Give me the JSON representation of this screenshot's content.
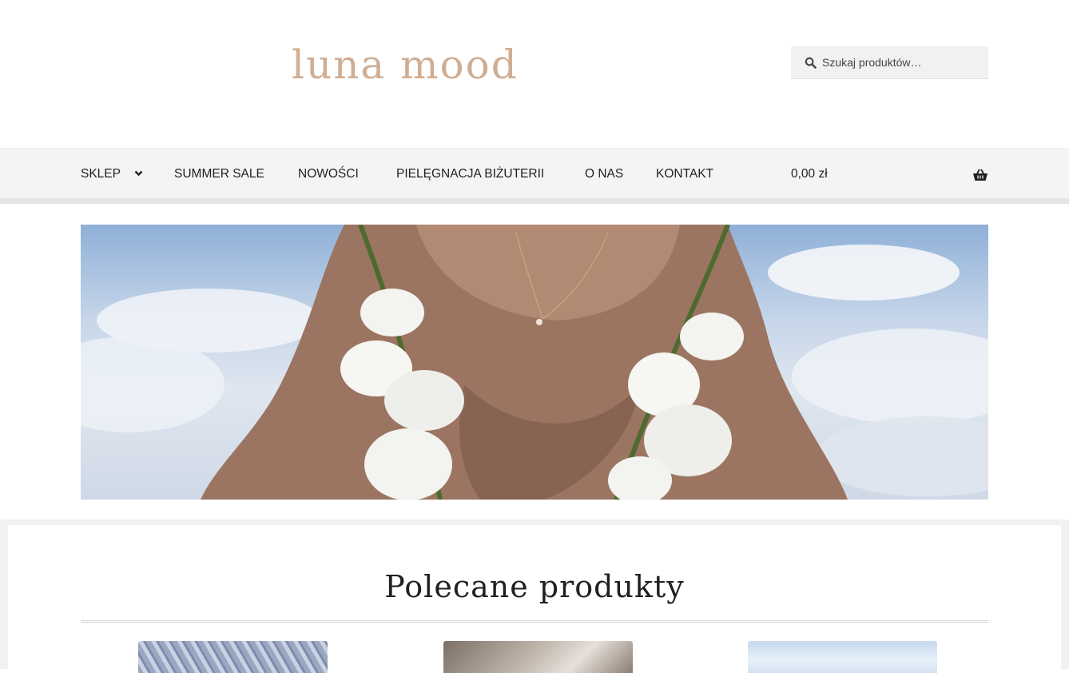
{
  "brand": {
    "logo_text": "luna mood",
    "accent": "#d0ae93"
  },
  "search": {
    "placeholder": "Szukaj produktów…",
    "icon": "search-icon"
  },
  "nav": {
    "items": [
      {
        "label": "SKLEP",
        "has_dropdown": true
      },
      {
        "label": "SUMMER SALE"
      },
      {
        "label": "NOWOŚCI"
      },
      {
        "label": "PIELĘGNACJA BIŻUTERII"
      },
      {
        "label": "O NAS"
      },
      {
        "label": "KONTAKT"
      }
    ],
    "dropdown_icon": "chevron-down-icon"
  },
  "cart": {
    "total": "0,00 zł",
    "icon": "basket-icon"
  },
  "main": {
    "featured_title": "Polecane produkty"
  }
}
